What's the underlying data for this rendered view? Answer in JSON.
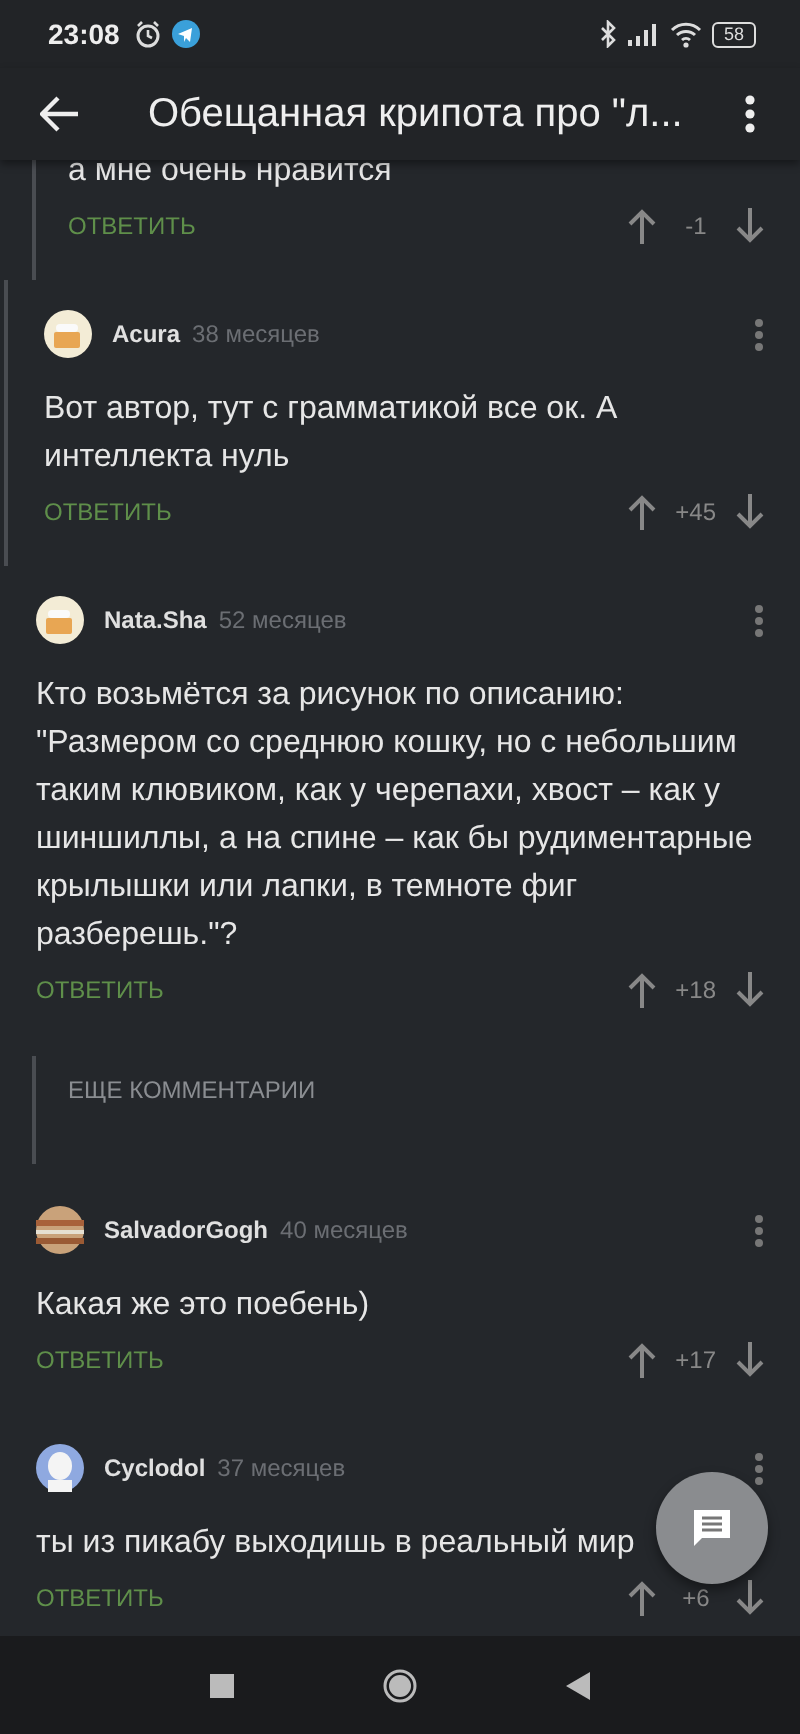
{
  "status_bar": {
    "time": "23:08",
    "battery": "58"
  },
  "app_bar": {
    "title": "Обещанная крипота про \"л..."
  },
  "comments": [
    {
      "kind": "partial",
      "threaded": true,
      "text": "а мне очень нравится",
      "reply": "ОТВЕТИТЬ",
      "score": "-1"
    },
    {
      "kind": "comment",
      "threaded": true,
      "avatar": {
        "kind": "cake"
      },
      "author": "Acura",
      "age": "38 месяцев",
      "text": "Вот автор, тут с грамматикой все ок. А интеллекта нуль",
      "reply": "ОТВЕТИТЬ",
      "score": "+45"
    },
    {
      "kind": "comment",
      "threaded": false,
      "avatar": {
        "kind": "cake"
      },
      "author": "Nata.Sha",
      "age": "52 месяцев",
      "text": "Кто возьмётся за рисунок по описанию: \"Размером со среднюю кошку, но с небольшим таким клювиком, как у черепахи, хвост – как у шиншиллы, а на спине – как бы рудиментарные крылышки или лапки, в темноте фиг разберешь.\"?",
      "reply": "ОТВЕТИТЬ",
      "score": "+18"
    },
    {
      "kind": "more",
      "threaded": true,
      "text": "ЕЩЕ КОММЕНТАРИИ"
    },
    {
      "kind": "comment",
      "threaded": false,
      "avatar": {
        "kind": "planet"
      },
      "author": "SalvadorGogh",
      "age": "40 месяцев",
      "text": "Какая же это поебень)",
      "reply": "ОТВЕТИТЬ",
      "score": "+17"
    },
    {
      "kind": "comment",
      "threaded": false,
      "avatar": {
        "kind": "figure"
      },
      "author": "Cyclodol",
      "age": "37 месяцев",
      "text": "ты из пикабу выходишь в реальный мир",
      "reply": "ОТВЕТИТЬ",
      "score": "+6"
    }
  ]
}
